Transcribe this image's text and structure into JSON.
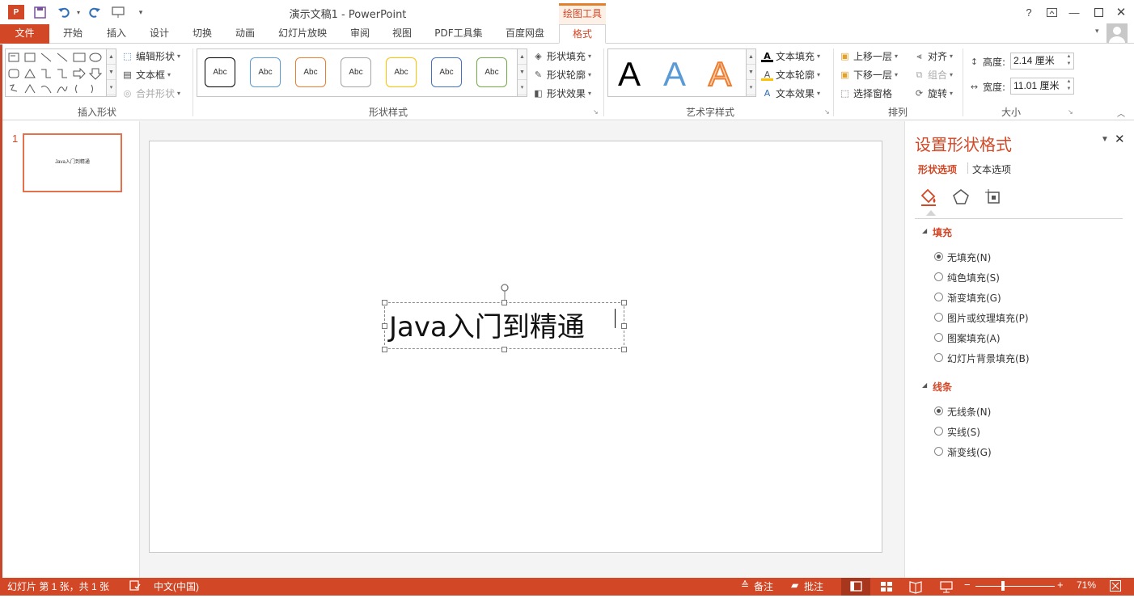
{
  "window": {
    "title": "演示文稿1 - PowerPoint",
    "context_tab_group": "绘图工具"
  },
  "tabs": [
    "文件",
    "开始",
    "插入",
    "设计",
    "切换",
    "动画",
    "幻灯片放映",
    "审阅",
    "视图",
    "PDF工具集",
    "百度网盘",
    "格式"
  ],
  "active_tab": "格式",
  "ribbon": {
    "insert_shapes": {
      "label": "插入形状",
      "edit_shape": "编辑形状",
      "textbox": "文本框",
      "merge_shapes": "合并形状"
    },
    "shape_styles": {
      "label": "形状样式",
      "swatch_text": "Abc",
      "swatch_colors": [
        "#000000",
        "#5b9bd5",
        "#ed7d31",
        "#a5a5a5",
        "#ffc000",
        "#4472c4",
        "#70ad47"
      ],
      "fill": "形状填充",
      "outline": "形状轮廓",
      "effects": "形状效果"
    },
    "wordart": {
      "label": "艺术字样式",
      "letter": "A",
      "text_fill": "文本填充",
      "text_outline": "文本轮廓",
      "text_effects": "文本效果"
    },
    "arrange": {
      "label": "排列",
      "bring_forward": "上移一层",
      "send_backward": "下移一层",
      "selection_pane": "选择窗格",
      "align": "对齐",
      "group": "组合",
      "rotate": "旋转"
    },
    "size": {
      "label": "大小",
      "height_label": "高度:",
      "height_value": "2.14 厘米",
      "width_label": "宽度:",
      "width_value": "11.01 厘米"
    }
  },
  "thumbnails": [
    {
      "number": "1",
      "text": "Java入门到精通"
    }
  ],
  "slide": {
    "textbox_text": "Java入门到精通"
  },
  "format_pane": {
    "title": "设置形状格式",
    "tabs": [
      "形状选项",
      "文本选项"
    ],
    "fill_section": "填充",
    "fill_options": [
      "无填充(N)",
      "纯色填充(S)",
      "渐变填充(G)",
      "图片或纹理填充(P)",
      "图案填充(A)",
      "幻灯片背景填充(B)"
    ],
    "fill_selected": 0,
    "line_section": "线条",
    "line_options": [
      "无线条(N)",
      "实线(S)",
      "渐变线(G)"
    ],
    "line_selected": 0
  },
  "statusbar": {
    "slide_info": "幻灯片 第 1 张，共 1 张",
    "language": "中文(中国)",
    "notes": "备注",
    "comments": "批注",
    "zoom": "71%"
  },
  "colors": {
    "accent": "#d24726",
    "context_tab": "#e2802c"
  }
}
